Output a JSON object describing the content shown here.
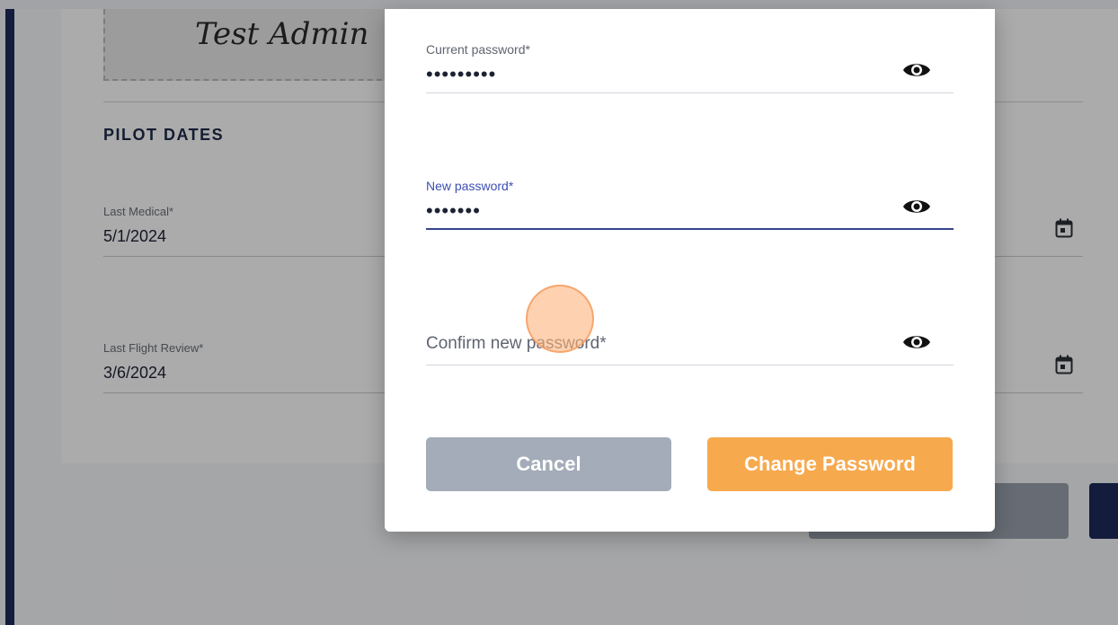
{
  "background_page": {
    "signature_text": "Test Admin",
    "section_title": "PILOT DATES",
    "fields": [
      {
        "label": "Last Medical*",
        "value": "5/1/2024",
        "icon": "calendar-icon"
      },
      {
        "label": "Last Flight Review*",
        "value": "3/6/2024",
        "icon": "calendar-icon"
      }
    ]
  },
  "dialog": {
    "current_password": {
      "label": "Current password*",
      "value": "•••••••••",
      "icon": "eye-icon"
    },
    "new_password": {
      "label": "New password*",
      "value": "•••••••",
      "icon": "eye-icon"
    },
    "confirm_password": {
      "placeholder": "Confirm new password*",
      "value": "",
      "icon": "eye-icon"
    },
    "cancel_label": "Cancel",
    "submit_label": "Change Password"
  },
  "colors": {
    "brand_navy": "#1d2a5a",
    "primary_orange": "#f7a94e",
    "cancel_gray": "#a3acb8",
    "focus_blue": "#3d4fb0"
  }
}
